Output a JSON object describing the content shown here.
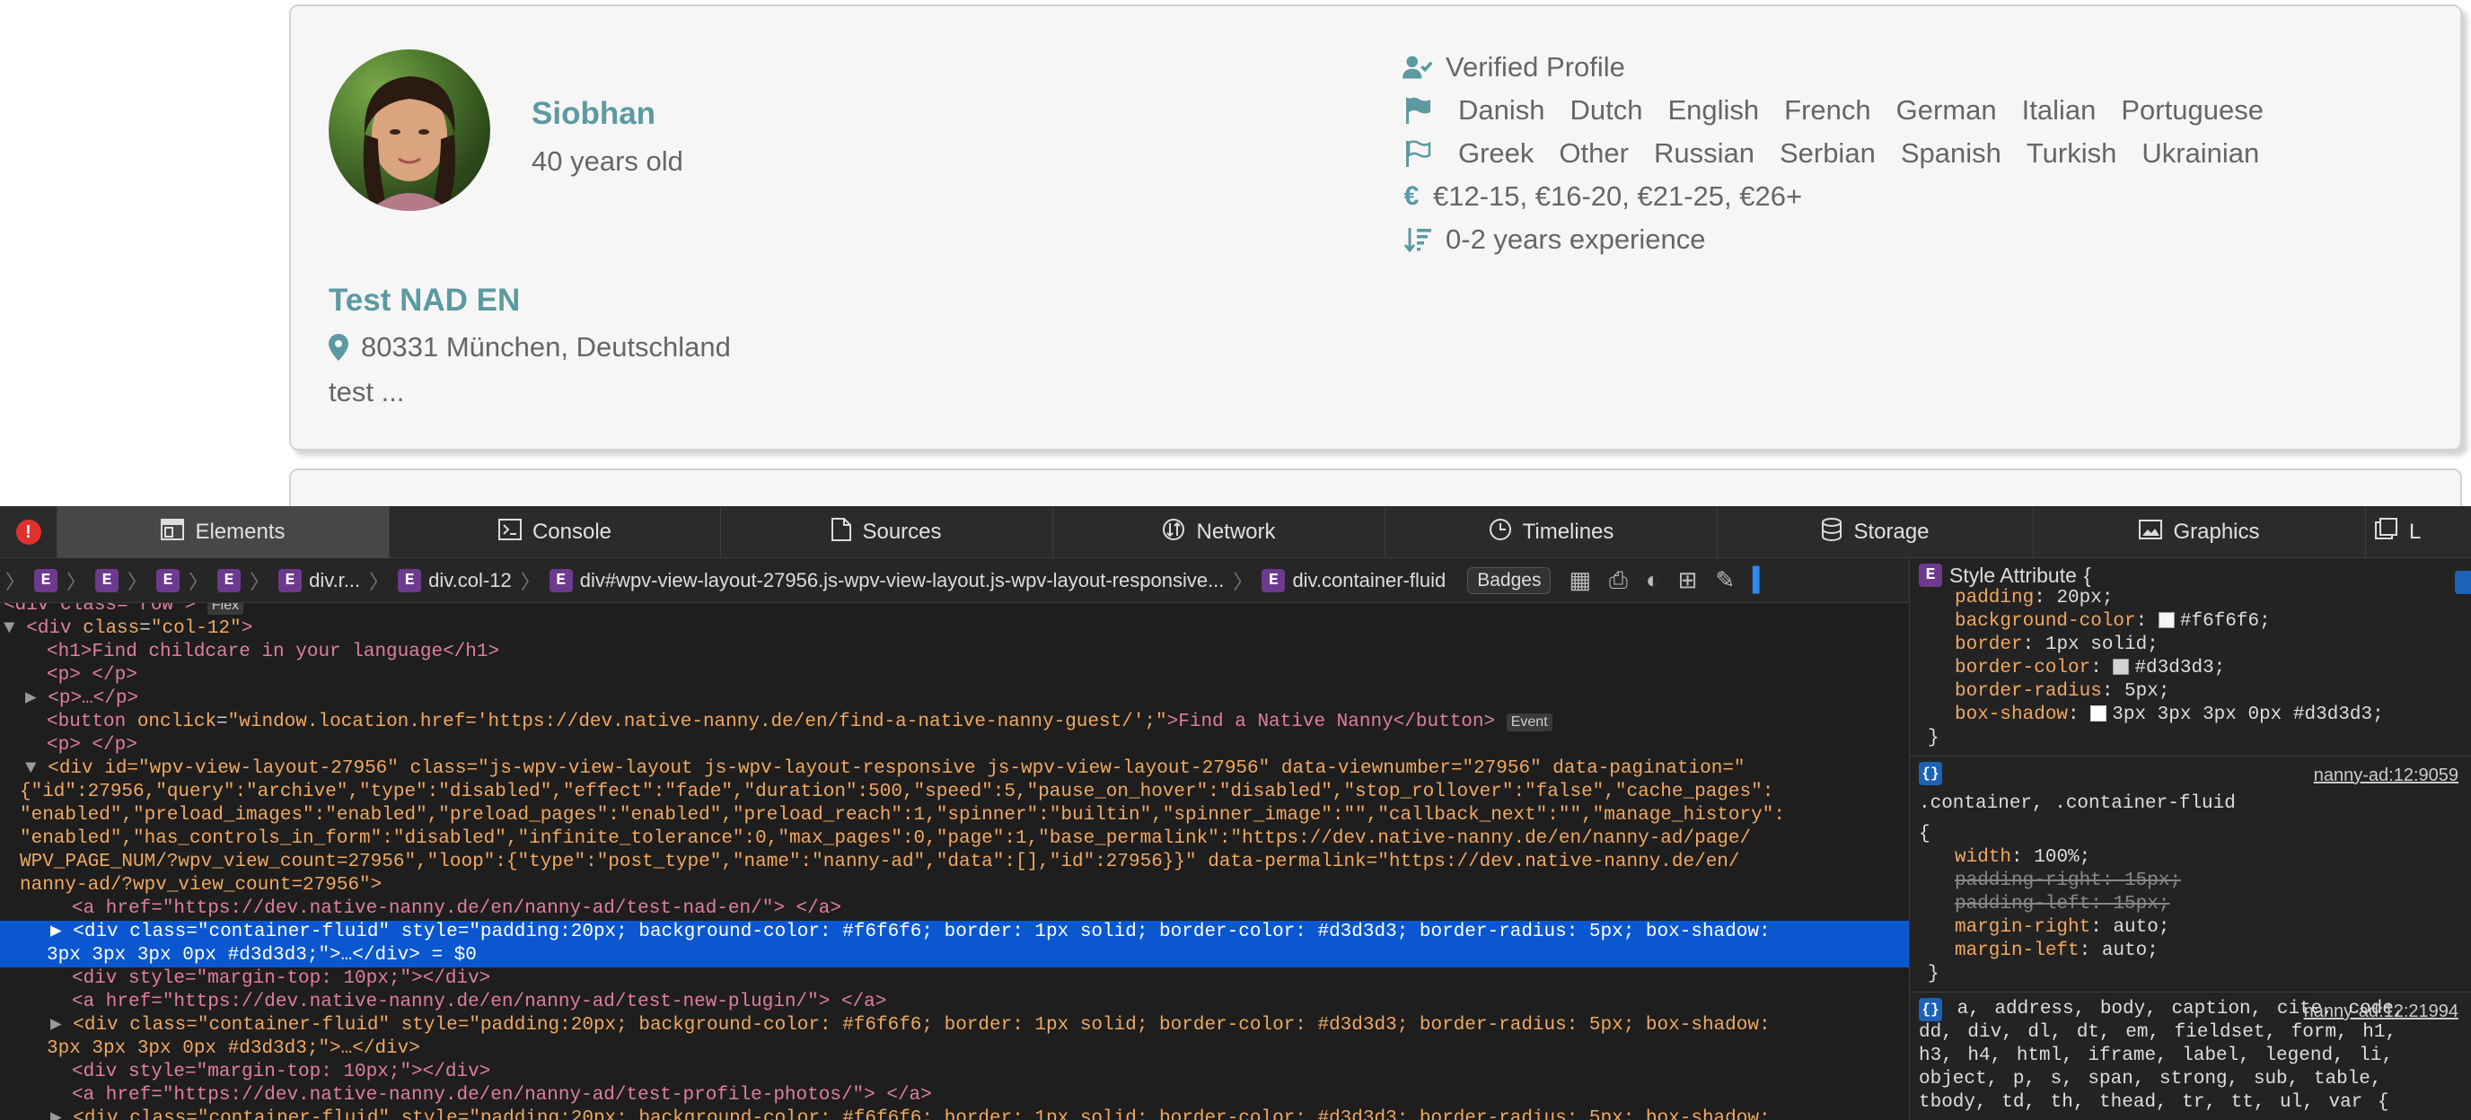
{
  "profile": {
    "name": "Siobhan",
    "age": "40 years old",
    "listing_title": "Test NAD EN",
    "location": "80331 München, Deutschland",
    "description": "test ...",
    "verified": "Verified Profile",
    "native_languages": [
      "Danish",
      "Dutch",
      "English",
      "French",
      "German",
      "Italian",
      "Portuguese"
    ],
    "other_languages": [
      "Greek",
      "Other",
      "Russian",
      "Serbian",
      "Spanish",
      "Turkish",
      "Ukrainian"
    ],
    "rates": "€12-15, €16-20, €21-25, €26+",
    "experience": "0-2 years experience",
    "accent_color": "#5b9aa0",
    "card_background": "#f6f6f6"
  },
  "devtools": {
    "tabs": [
      {
        "label": "Elements",
        "icon": "elements-icon"
      },
      {
        "label": "Console",
        "icon": "console-icon"
      },
      {
        "label": "Sources",
        "icon": "sources-icon"
      },
      {
        "label": "Network",
        "icon": "network-icon"
      },
      {
        "label": "Timelines",
        "icon": "timelines-icon"
      },
      {
        "label": "Storage",
        "icon": "storage-icon"
      },
      {
        "label": "Graphics",
        "icon": "graphics-icon"
      },
      {
        "label": "L",
        "icon": "layers-icon"
      }
    ],
    "breadcrumbs": [
      "div.r...",
      "div.col-12",
      "div#wpv-view-layout-27956.js-wpv-view-layout.js-wpv-layout-responsive...",
      "div.container-fluid"
    ],
    "badges_label": "Badges",
    "event_badge": "Event",
    "flex_badge": "Flex",
    "dom_lines": {
      "l0": "<div class=\"row\">",
      "l1_tag": "<div ",
      "l1_attr": "class",
      "l1_val": "\"col-12\"",
      "l2": "<h1>Find childcare in your language</h1>",
      "l3": "<p> </p>",
      "l4": "<p>…</p>",
      "l5a": "<button ",
      "l5b": "onclick",
      "l5c": "\"window.location.href='https://dev.native-nanny.de/en/find-a-native-nanny-guest/';\"",
      "l5d": ">Find a Native Nanny</button>",
      "l6": "<p> </p>",
      "l7": "<div id=\"wpv-view-layout-27956\" class=\"js-wpv-view-layout js-wpv-layout-responsive js-wpv-view-layout-27956\" data-viewnumber=\"27956\" data-pagination=\"",
      "l8": "{\"id\":27956,\"query\":\"archive\",\"type\":\"disabled\",\"effect\":\"fade\",\"duration\":500,\"speed\":5,\"pause_on_hover\":\"disabled\",\"stop_rollover\":\"false\",\"cache_pages\":",
      "l9": "\"enabled\",\"preload_images\":\"enabled\",\"preload_pages\":\"enabled\",\"preload_reach\":1,\"spinner\":\"builtin\",\"spinner_image\":\"\",\"callback_next\":\"\",\"manage_history\":",
      "l10": "\"enabled\",\"has_controls_in_form\":\"disabled\",\"infinite_tolerance\":0,\"max_pages\":0,\"page\":1,\"base_permalink\":\"https://dev.native-nanny.de/en/nanny-ad/page/",
      "l11": "WPV_PAGE_NUM/?wpv_view_count=27956\",\"loop\":{\"type\":\"post_type\",\"name\":\"nanny-ad\",\"data\":[],\"id\":27956}}\" data-permalink=\"https://dev.native-nanny.de/en/",
      "l12": "nanny-ad/?wpv_view_count=27956\">",
      "l13": "<a href=\"https://dev.native-nanny.de/en/nanny-ad/test-nad-en/\"> </a>",
      "l14": "<div class=\"container-fluid\" style=\"padding:20px; background-color: #f6f6f6; border: 1px solid; border-color: #d3d3d3; border-radius: 5px; box-shadow:",
      "l15": "3px 3px 3px 0px #d3d3d3;\">…</div> = $0",
      "l16": "<div style=\"margin-top: 10px;\"></div>",
      "l17": "<a href=\"https://dev.native-nanny.de/en/nanny-ad/test-new-plugin/\"> </a>",
      "l18": "<div class=\"container-fluid\" style=\"padding:20px; background-color: #f6f6f6; border: 1px solid; border-color: #d3d3d3; border-radius: 5px; box-shadow:",
      "l19": "3px 3px 3px 0px #d3d3d3;\">…</div>",
      "l20": "<div style=\"margin-top: 10px;\"></div>",
      "l21": "<a href=\"https://dev.native-nanny.de/en/nanny-ad/test-profile-photos/\"> </a>",
      "l22": "<div class=\"container-fluid\" style=\"padding:20px; background-color: #f6f6f6; border: 1px solid; border-color: #d3d3d3; border-radius: 5px; box-shadow:"
    },
    "styles": {
      "style_attr_title": "Style Attribute",
      "style_attr_props": [
        {
          "name": "padding",
          "value": "20px;"
        },
        {
          "name": "background-color",
          "value": "#f6f6f6;",
          "swatch": "#f6f6f6"
        },
        {
          "name": "border",
          "value": "1px solid;"
        },
        {
          "name": "border-color",
          "value": "#d3d3d3;",
          "swatch": "#d3d3d3"
        },
        {
          "name": "border-radius",
          "value": "5px;"
        },
        {
          "name": "box-shadow",
          "value": "3px 3px 3px 0px #d3d3d3;"
        }
      ],
      "rule2_selector": ".container, .container-fluid",
      "rule2_source": "nanny-ad:12:9059",
      "rule2_props": [
        {
          "name": "width",
          "value": "100%;",
          "struck": false
        },
        {
          "name": "padding-right",
          "value": "15px;",
          "struck": true
        },
        {
          "name": "padding-left",
          "value": "15px;",
          "struck": true
        },
        {
          "name": "margin-right",
          "value": "auto;",
          "struck": false
        },
        {
          "name": "margin-left",
          "value": "auto;",
          "struck": false
        }
      ],
      "rule3_selector": "a, address, body, caption, cite, code, dd, div, dl, dt, em, fieldset, form, h1, h3, h4, html, iframe, label, legend, li, object, p, s, span, strong, sub, table, tbody, td, th, thead, tr, tt, ul, var {",
      "rule3_source": "nanny-ad:12:21994"
    }
  }
}
